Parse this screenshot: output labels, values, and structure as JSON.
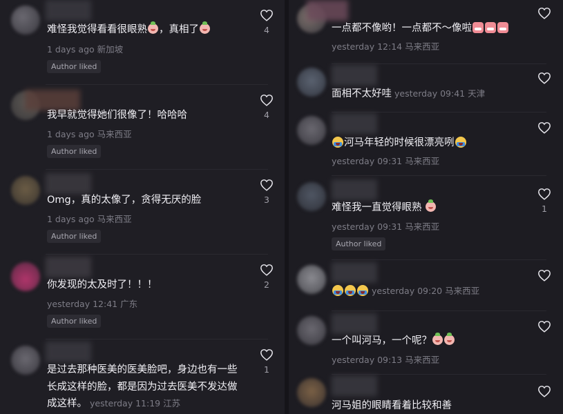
{
  "left_comments": [
    {
      "text": "难怪我觉得看看很眼熟",
      "text_after": "，真相了",
      "meta": "1 days ago 新加坡",
      "badge": "Author liked",
      "likes": "4"
    },
    {
      "text": "我早就觉得她们很像了！哈哈哈",
      "meta": "1 days ago 马来西亚",
      "badge": "Author liked",
      "likes": "4"
    },
    {
      "text": "Omg，真的太像了，贪得无厌的脸",
      "meta": "1 days ago 马来西亚",
      "badge": "Author liked",
      "likes": "3"
    },
    {
      "text": "你发现的太及时了！！！",
      "meta": "yesterday 12:41 广东",
      "badge": "Author liked",
      "likes": "2"
    },
    {
      "text_line1": "是过去那种医美的医美脸吧，身边也有一些",
      "text_line2": "长成这样的脸，都是因为过去医美不发达做",
      "text_line3": "成这样。",
      "meta": "yesterday 11:19 江苏",
      "likes": "1"
    }
  ],
  "right_comments": [
    {
      "text": "一点都不像哟！一点都不～像啦",
      "meta": "yesterday 12:14 马来西亚"
    },
    {
      "text": "面相不太好哇",
      "meta": "yesterday 09:41 天津"
    },
    {
      "text": "河马年轻的时候很漂亮咧",
      "meta": "yesterday 09:31 马来西亚"
    },
    {
      "text": "难怪我一直觉得眼熟",
      "meta": "yesterday 09:31 马来西亚",
      "badge": "Author liked",
      "likes": "1"
    },
    {
      "text": "",
      "meta": "yesterday 09:20 马来西亚"
    },
    {
      "text": "一个叫河马，一个呢？",
      "meta": "yesterday 09:13 马来西亚"
    },
    {
      "text": "河马姐的眼睛看着比较和善"
    }
  ],
  "icons": {
    "like": "heart-outline-icon",
    "emoji_peach": "peach-face-emoji",
    "emoji_cry": "crying-face-emoji",
    "emoji_angry": "red-face-emoji"
  },
  "colors": {
    "background": "#1f1e24",
    "text": "#f1f0f5",
    "meta": "#7e7d87",
    "badge_bg": "#2d2c33"
  }
}
